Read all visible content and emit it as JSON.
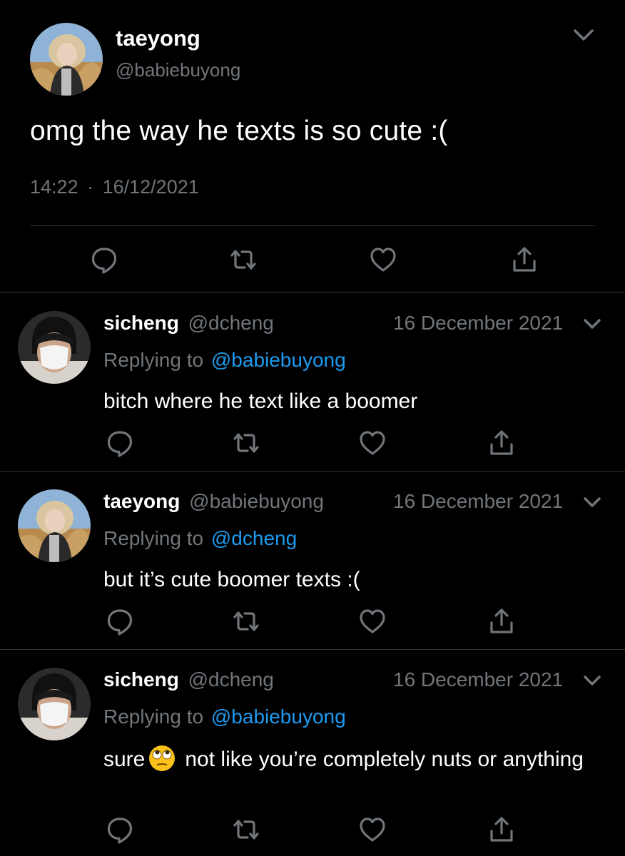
{
  "main_tweet": {
    "display_name": "taeyong",
    "handle": "@babiebuyong",
    "text": "omg the way he texts is so cute :(",
    "time": "14:22",
    "separator": "·",
    "date": "16/12/2021",
    "icons": [
      "reply-icon",
      "retweet-icon",
      "like-icon",
      "share-icon"
    ]
  },
  "replies": [
    {
      "display_name": "sicheng",
      "handle": "@dcheng",
      "date": "16 December 2021",
      "replying_prefix": "Replying to",
      "replying_to": "@babiebuyong",
      "text": "bitch where he text like a boomer"
    },
    {
      "display_name": "taeyong",
      "handle": "@babiebuyong",
      "date": "16 December 2021",
      "replying_prefix": "Replying to",
      "replying_to": "@dcheng",
      "text": "but it’s cute boomer texts :("
    },
    {
      "display_name": "sicheng",
      "handle": "@dcheng",
      "date": "16 December 2021",
      "replying_prefix": "Replying to",
      "replying_to": "@babiebuyong",
      "text_before_emoji": "sure",
      "emoji": "face-with-rolling-eyes",
      "text_after_emoji": "not like you’re completely nuts or anything"
    }
  ],
  "colors": {
    "background": "#000000",
    "text": "#ffffff",
    "muted": "#71767b",
    "link": "#1d9bf0",
    "divider": "#2f3336"
  }
}
